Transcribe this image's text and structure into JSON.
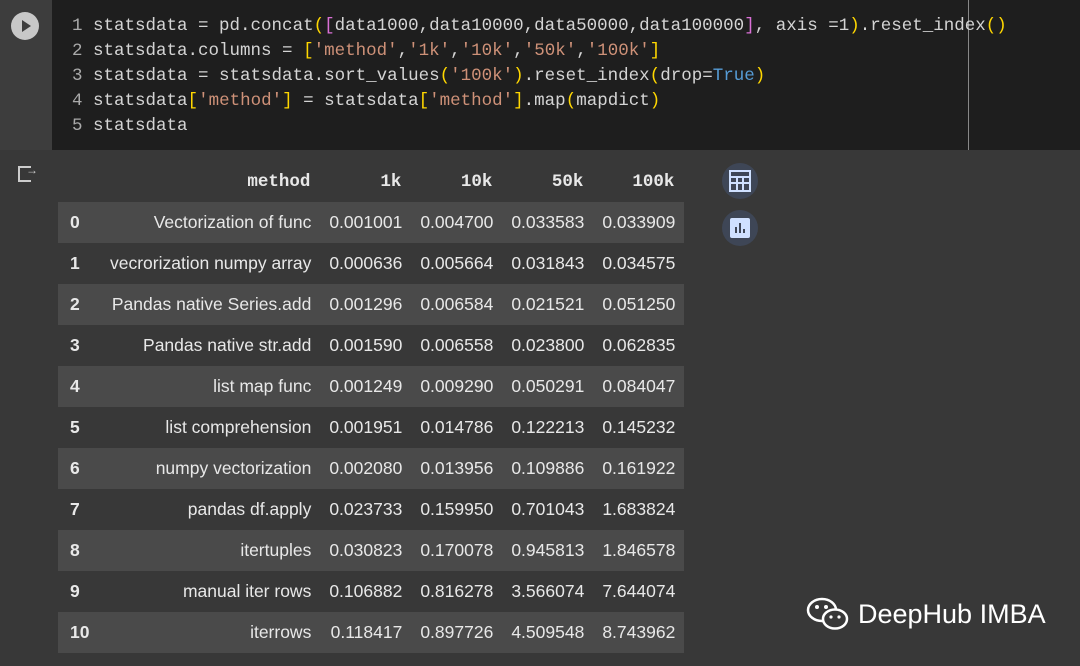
{
  "code_lines": [
    {
      "n": "1",
      "parts": [
        [
          "",
          "statsdata = pd.concat"
        ],
        [
          "b1",
          "("
        ],
        [
          "b2",
          "["
        ],
        [
          "",
          "data1000,data10000,data50000,data100000"
        ],
        [
          "b2",
          "]"
        ],
        [
          "",
          ", axis =1"
        ],
        [
          "b1",
          ")"
        ],
        [
          "",
          ".reset_index"
        ],
        [
          "b1",
          "()"
        ]
      ]
    },
    {
      "n": "2",
      "parts": [
        [
          "",
          "statsdata.columns = "
        ],
        [
          "b1",
          "["
        ],
        [
          "s",
          "'method'"
        ],
        [
          "",
          ","
        ],
        [
          "s",
          "'1k'"
        ],
        [
          "",
          ","
        ],
        [
          "s",
          "'10k'"
        ],
        [
          "",
          ","
        ],
        [
          "s",
          "'50k'"
        ],
        [
          "",
          ","
        ],
        [
          "s",
          "'100k'"
        ],
        [
          "b1",
          "]"
        ]
      ]
    },
    {
      "n": "3",
      "parts": [
        [
          "",
          "statsdata = statsdata.sort_values"
        ],
        [
          "b1",
          "("
        ],
        [
          "s",
          "'100k'"
        ],
        [
          "b1",
          ")"
        ],
        [
          "",
          ".reset_index"
        ],
        [
          "b1",
          "("
        ],
        [
          "",
          "drop="
        ],
        [
          "k",
          "True"
        ],
        [
          "b1",
          ")"
        ]
      ]
    },
    {
      "n": "4",
      "parts": [
        [
          "",
          "statsdata"
        ],
        [
          "b1",
          "["
        ],
        [
          "s",
          "'method'"
        ],
        [
          "b1",
          "]"
        ],
        [
          "",
          " = statsdata"
        ],
        [
          "b1",
          "["
        ],
        [
          "s",
          "'method'"
        ],
        [
          "b1",
          "]"
        ],
        [
          "",
          ".map"
        ],
        [
          "b1",
          "("
        ],
        [
          "",
          "mapdict"
        ],
        [
          "b1",
          ")"
        ]
      ]
    },
    {
      "n": "5",
      "parts": [
        [
          "",
          "statsdata"
        ]
      ]
    }
  ],
  "table": {
    "headers": [
      "",
      "method",
      "1k",
      "10k",
      "50k",
      "100k"
    ],
    "rows": [
      [
        "0",
        "Vectorization of func",
        "0.001001",
        "0.004700",
        "0.033583",
        "0.033909"
      ],
      [
        "1",
        "vecrorization numpy array",
        "0.000636",
        "0.005664",
        "0.031843",
        "0.034575"
      ],
      [
        "2",
        "Pandas native Series.add",
        "0.001296",
        "0.006584",
        "0.021521",
        "0.051250"
      ],
      [
        "3",
        "Pandas native str.add",
        "0.001590",
        "0.006558",
        "0.023800",
        "0.062835"
      ],
      [
        "4",
        "list map func",
        "0.001249",
        "0.009290",
        "0.050291",
        "0.084047"
      ],
      [
        "5",
        "list comprehension",
        "0.001951",
        "0.014786",
        "0.122213",
        "0.145232"
      ],
      [
        "6",
        "numpy vectorization",
        "0.002080",
        "0.013956",
        "0.109886",
        "0.161922"
      ],
      [
        "7",
        "pandas df.apply",
        "0.023733",
        "0.159950",
        "0.701043",
        "1.683824"
      ],
      [
        "8",
        "itertuples",
        "0.030823",
        "0.170078",
        "0.945813",
        "1.846578"
      ],
      [
        "9",
        "manual iter rows",
        "0.106882",
        "0.816278",
        "3.566074",
        "7.644074"
      ],
      [
        "10",
        "iterrows",
        "0.118417",
        "0.897726",
        "4.509548",
        "8.743962"
      ]
    ]
  },
  "watermark": "DeepHub IMBA"
}
